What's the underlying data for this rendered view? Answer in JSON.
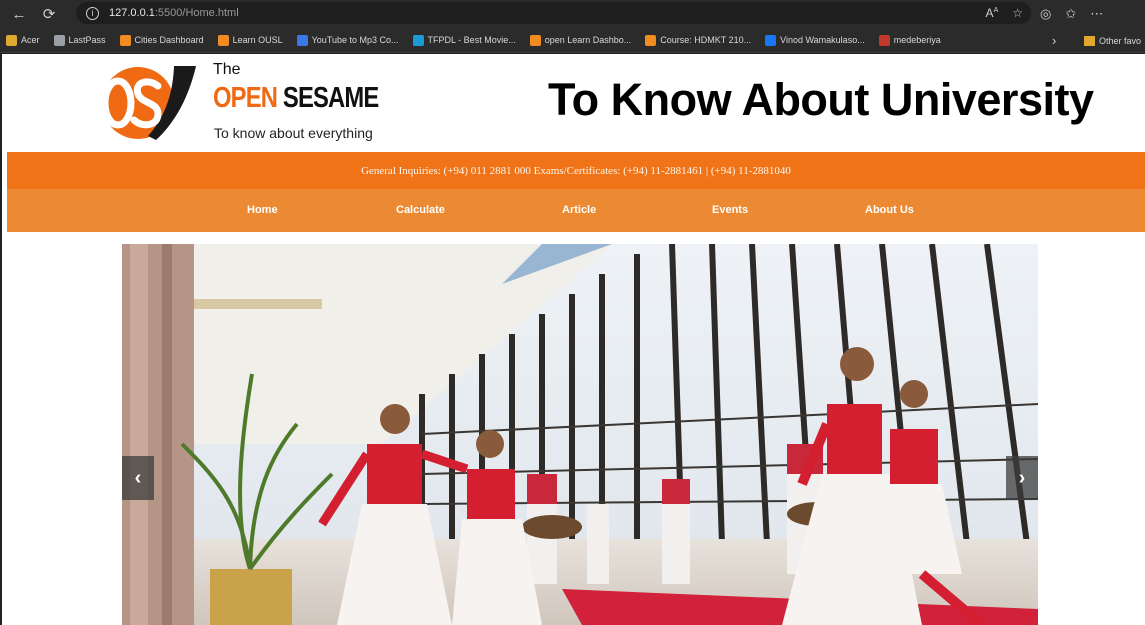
{
  "browser": {
    "address_host": "127.0.0.1",
    "address_path": ":5500/Home.html",
    "bookmarks": [
      {
        "label": "Acer",
        "color": "#e0a82e"
      },
      {
        "label": "LastPass",
        "color": "#9aa0a6"
      },
      {
        "label": "Cities Dashboard",
        "color": "#f28b22"
      },
      {
        "label": "Learn OUSL",
        "color": "#f28b22"
      },
      {
        "label": "YouTube to Mp3 Co...",
        "color": "#3b78e7"
      },
      {
        "label": "TFPDL - Best Movie...",
        "color": "#1a9bd7"
      },
      {
        "label": "open Learn Dashbo...",
        "color": "#f28b22"
      },
      {
        "label": "Course: HDMKT 210...",
        "color": "#f28b22"
      },
      {
        "label": "Vinod Wamakulaso...",
        "color": "#1877f2"
      },
      {
        "label": "medeberiya",
        "color": "#c0392b"
      }
    ],
    "other_favorites": "Other favo"
  },
  "header": {
    "logo_the": "The",
    "logo_open": "OPEN",
    "logo_sesame": "SESAME",
    "logo_tagline": "To know about everything",
    "site_title": "To Know About University"
  },
  "inquiry_text": "General Inquiries: (+94) 011 2881 000 Exams/Certificates: (+94) 11-2881461 | (+94) 11-2881040",
  "nav": {
    "home": "Home",
    "calculate": "Calculate",
    "article": "Article",
    "events": "Events",
    "about": "About Us"
  },
  "slider": {
    "prev": "‹",
    "next": "›"
  },
  "colors": {
    "brand_orange": "#f07417",
    "nav_orange": "#ec8a34"
  }
}
